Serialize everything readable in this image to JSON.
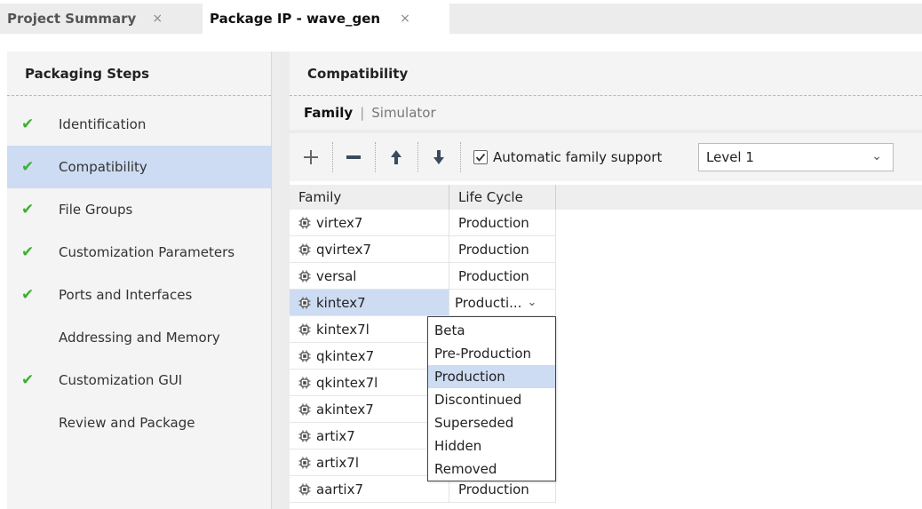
{
  "tabs": [
    {
      "label": "Project Summary",
      "close": "×"
    },
    {
      "label": "Package IP - wave_gen",
      "close": "×"
    }
  ],
  "left_panel": {
    "title": "Packaging Steps",
    "steps": [
      {
        "label": "Identification",
        "done": true
      },
      {
        "label": "Compatibility",
        "done": true
      },
      {
        "label": "File Groups",
        "done": true
      },
      {
        "label": "Customization Parameters",
        "done": true
      },
      {
        "label": "Ports and Interfaces",
        "done": true
      },
      {
        "label": "Addressing and Memory",
        "done": false
      },
      {
        "label": "Customization GUI",
        "done": true
      },
      {
        "label": "Review and Package",
        "done": false
      }
    ],
    "check_glyph": "✔",
    "selected_step": "Compatibility"
  },
  "right_panel": {
    "title": "Compatibility",
    "subtabs": {
      "active": "Family",
      "separator": "|",
      "other": "Simulator"
    },
    "toolbar": {
      "auto_family_label": "Automatic family support",
      "auto_family_checked": true,
      "level_value": "Level 1",
      "level_chevron": "⌄"
    },
    "table": {
      "columns": [
        "Family",
        "Life Cycle"
      ],
      "rows": [
        {
          "family": "virtex7",
          "life": "Production"
        },
        {
          "family": "qvirtex7",
          "life": "Production"
        },
        {
          "family": "versal",
          "life": "Production"
        },
        {
          "family": "kintex7",
          "life": "Producti...",
          "editing": true
        },
        {
          "family": "kintex7l",
          "life": ""
        },
        {
          "family": "qkintex7",
          "life": ""
        },
        {
          "family": "qkintex7l",
          "life": ""
        },
        {
          "family": "akintex7",
          "life": ""
        },
        {
          "family": "artix7",
          "life": ""
        },
        {
          "family": "artix7l",
          "life": ""
        },
        {
          "family": "aartix7",
          "life": "Production"
        }
      ],
      "edit_chevron": "⌄"
    },
    "lifecycle_dropdown": {
      "options": [
        "Beta",
        "Pre-Production",
        "Production",
        "Discontinued",
        "Superseded",
        "Hidden",
        "Removed"
      ],
      "highlighted": "Production"
    }
  },
  "colors": {
    "accent_selected": "#cddcf3",
    "check_green": "#3cb02f",
    "icon_dark": "#3b4a5e"
  }
}
